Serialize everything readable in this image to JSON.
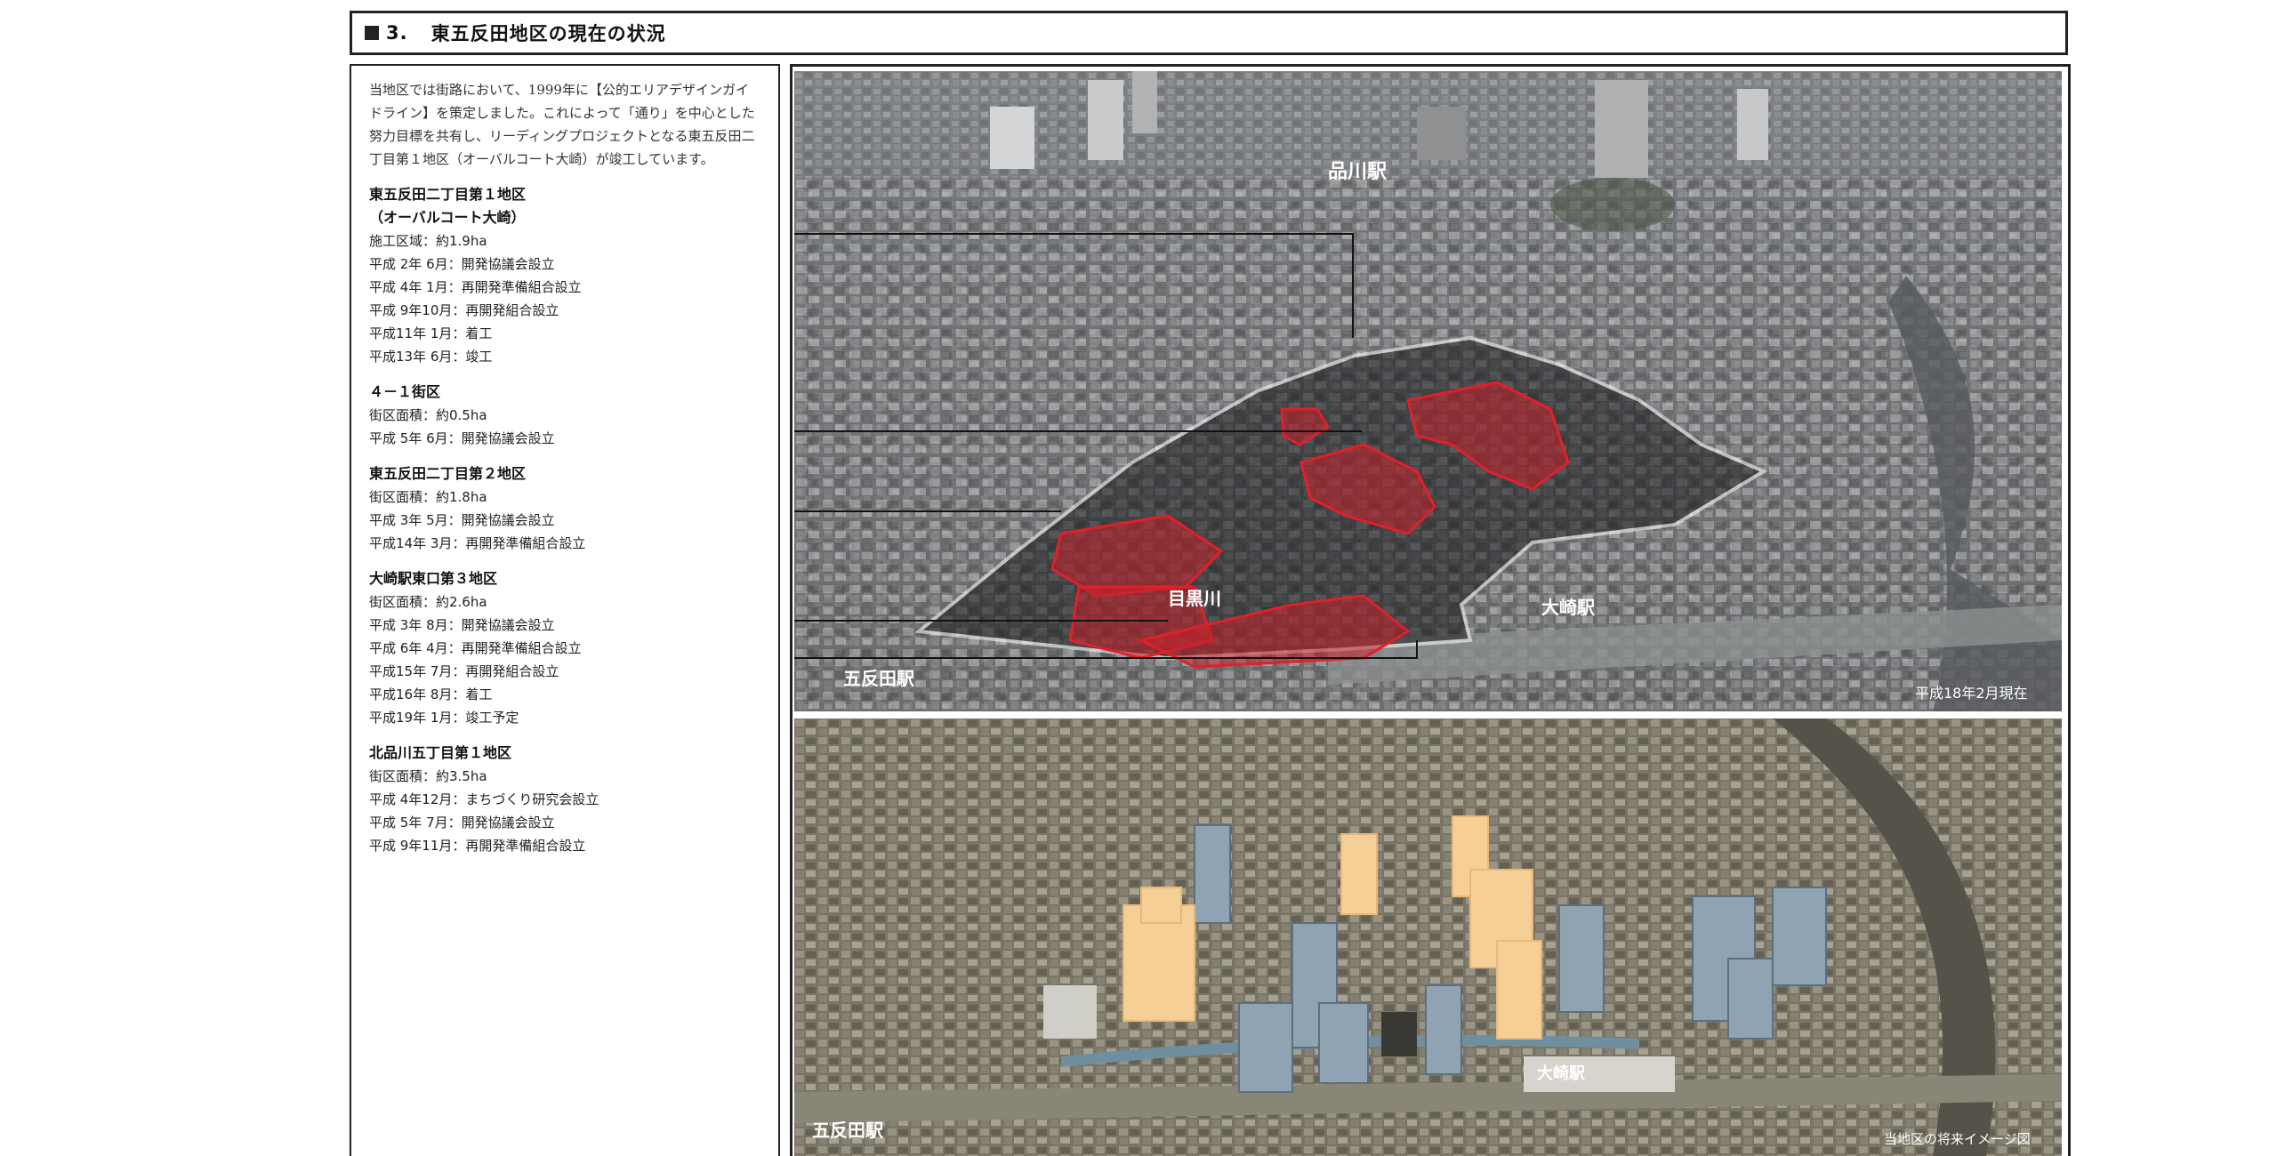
{
  "header": {
    "number": "3.",
    "title": "東五反田地区の現在の状況"
  },
  "intro": {
    "text": "当地区では街路において、1999年に【公的エリアデザインガイドライン】を策定しました。これによって「通り」を中心とした努力目標を共有し、リーディングプロジェクトとなる東五反田二丁目第１地区（オーバルコート大崎）が竣工しています。"
  },
  "sites": [
    {
      "name": "東五反田二丁目第１地区",
      "subname": "（オーバルコート大崎）",
      "lines": [
        "施工区域：約1.9ha",
        "平成 2年 6月：開発協議会設立",
        "平成 4年 1月：再開発準備組合設立",
        "平成 9年10月：再開発組合設立",
        "平成11年 1月：着工",
        "平成13年 6月：竣工"
      ]
    },
    {
      "name": "４－１街区",
      "lines": [
        "街区面積：約0.5ha",
        "平成 5年 6月：開発協議会設立"
      ]
    },
    {
      "name": "東五反田二丁目第２地区",
      "lines": [
        "街区面積：約1.8ha",
        "平成 3年 5月：開発協議会設立",
        "平成14年 3月：再開発準備組合設立"
      ]
    },
    {
      "name": "大崎駅東口第３地区",
      "lines": [
        "街区面積：約2.6ha",
        "平成 3年 8月：開発協議会設立",
        "平成 6年 4月：再開発準備組合設立",
        "平成15年 7月：再開発組合設立",
        "平成16年 8月：着工",
        "平成19年 1月：竣工予定"
      ]
    },
    {
      "name": "北品川五丁目第１地区",
      "lines": [
        "街区面積：約3.5ha",
        "平成 4年12月：まちづくり研究会設立",
        "平成 5年 7月：開発協議会設立",
        "平成 9年11月：再開発準備組合設立"
      ]
    }
  ],
  "photo_top": {
    "labels": {
      "station_shinagawa": "品川駅",
      "station_osaki": "大崎駅",
      "station_gotanda": "五反田駅",
      "river": "目黒川",
      "date": "平成18年2月現在"
    }
  },
  "photo_bottom": {
    "labels": {
      "station_gotanda": "五反田駅",
      "station_osaki": "大崎駅",
      "caption": "当地区の将来イメージ図"
    }
  },
  "colors": {
    "highlight_red": "#c8202a",
    "future_building": "#f6cf96"
  }
}
